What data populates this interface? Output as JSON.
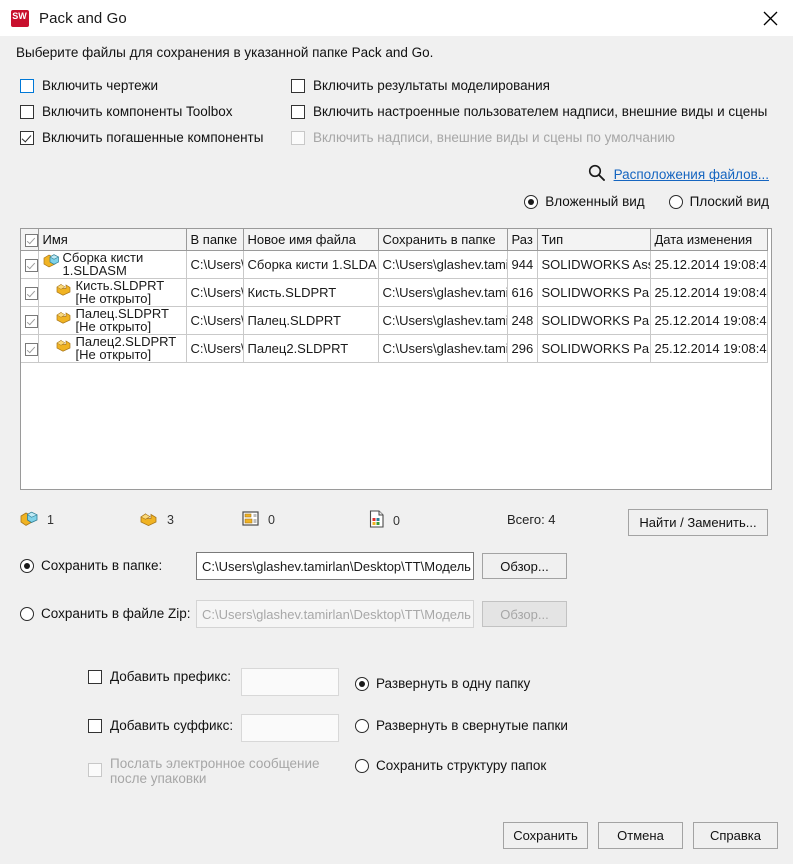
{
  "window": {
    "title": "Pack and Go",
    "logo_icon": "solidworks-logo-icon",
    "close_icon": "close-icon"
  },
  "instruction": "Выберите файлы для сохранения в указанной папке Pack and Go.",
  "options": {
    "left": [
      {
        "label": "Включить чертежи",
        "checked": false,
        "disabled": false,
        "focused": true
      },
      {
        "label": "Включить компоненты Toolbox",
        "checked": false,
        "disabled": false,
        "focused": false
      },
      {
        "label": "Включить погашенные компоненты",
        "checked": true,
        "disabled": false,
        "focused": false
      }
    ],
    "right": [
      {
        "label": "Включить результаты моделирования",
        "checked": false,
        "disabled": false
      },
      {
        "label": "Включить настроенные пользователем надписи, внешние виды и сцены",
        "checked": false,
        "disabled": false
      },
      {
        "label": "Включить надписи, внешние виды и сцены по умолчанию",
        "checked": false,
        "disabled": true
      }
    ]
  },
  "file_locations": {
    "icon": "search-icon",
    "link_label": "Расположения файлов..."
  },
  "view_mode": {
    "options": [
      {
        "label": "Вложенный вид",
        "selected": true
      },
      {
        "label": "Плоский вид",
        "selected": false
      }
    ]
  },
  "table": {
    "header_check_state": "checked",
    "columns": [
      "Имя",
      "В папке",
      "Новое имя файла",
      "Сохранить в папке",
      "Раз",
      "Тип",
      "Дата изменения"
    ],
    "rows": [
      {
        "checked": true,
        "icon": "assembly-icon",
        "indent": 0,
        "name": "Сборка кисти 1.SLDASM",
        "folder": "C:\\Users\\",
        "new_name": "Сборка кисти 1.SLDA",
        "save_in": "C:\\Users\\glashev.tamir",
        "size": "944",
        "type": "SOLIDWORKS Ass",
        "date": "25.12.2014 19:08:4"
      },
      {
        "checked": true,
        "icon": "part-icon",
        "indent": 1,
        "name": "Кисть.SLDPRT [Не открыто]",
        "folder": "C:\\Users\\",
        "new_name": "Кисть.SLDPRT",
        "save_in": "C:\\Users\\glashev.tamir",
        "size": "616",
        "type": "SOLIDWORKS Part",
        "date": "25.12.2014 19:08:4"
      },
      {
        "checked": true,
        "icon": "part-icon",
        "indent": 1,
        "name": "Палец.SLDPRT [Не открыто]",
        "folder": "C:\\Users\\",
        "new_name": "Палец.SLDPRT",
        "save_in": "C:\\Users\\glashev.tamir",
        "size": "248",
        "type": "SOLIDWORKS Part",
        "date": "25.12.2014 19:08:4"
      },
      {
        "checked": true,
        "icon": "part-icon",
        "indent": 1,
        "name": "Палец2.SLDPRT [Не открыто]",
        "folder": "C:\\Users\\",
        "new_name": "Палец2.SLDPRT",
        "save_in": "C:\\Users\\glashev.tamir",
        "size": "296",
        "type": "SOLIDWORKS Part",
        "date": "25.12.2014 19:08:4"
      }
    ]
  },
  "counters": {
    "assemblies": {
      "icon": "assembly-icon",
      "count": "1"
    },
    "parts": {
      "icon": "part-icon",
      "count": "3"
    },
    "drawings": {
      "icon": "drawing-icon",
      "count": "0"
    },
    "other": {
      "icon": "document-icon",
      "count": "0"
    },
    "total_label": "Всего: 4"
  },
  "find_replace_button": "Найти / Заменить...",
  "save_targets": {
    "folder": {
      "radio_label": "Сохранить в папке:",
      "selected": true,
      "path_value": "C:\\Users\\glashev.tamirlan\\Desktop\\TT\\Модель",
      "browse_label": "Обзор...",
      "browse_disabled": false
    },
    "zip": {
      "radio_label": "Сохранить в файле Zip:",
      "selected": false,
      "path_value": "C:\\Users\\glashev.tamirlan\\Desktop\\TT\\Модель",
      "browse_label": "Обзор...",
      "browse_disabled": true
    }
  },
  "naming": {
    "prefix": {
      "label": "Добавить префикс:",
      "checked": false,
      "value": "",
      "disabled": false
    },
    "suffix": {
      "label": "Добавить суффикс:",
      "checked": false,
      "value": "",
      "disabled": false
    },
    "email": {
      "label": "Послать электронное сообщение после упаковки",
      "checked": false,
      "disabled": true
    }
  },
  "structure": {
    "options": [
      {
        "label": "Развернуть в одну папку",
        "selected": true
      },
      {
        "label": "Развернуть в свернутые папки",
        "selected": false
      },
      {
        "label": "Сохранить структуру папок",
        "selected": false
      }
    ]
  },
  "footer": {
    "save": "Сохранить",
    "cancel": "Отмена",
    "help": "Справка"
  },
  "colors": {
    "link": "#1565c0",
    "accent_focus": "#0078d7",
    "window_bg": "#f0f0f0",
    "logo_red": "#c8102e"
  }
}
